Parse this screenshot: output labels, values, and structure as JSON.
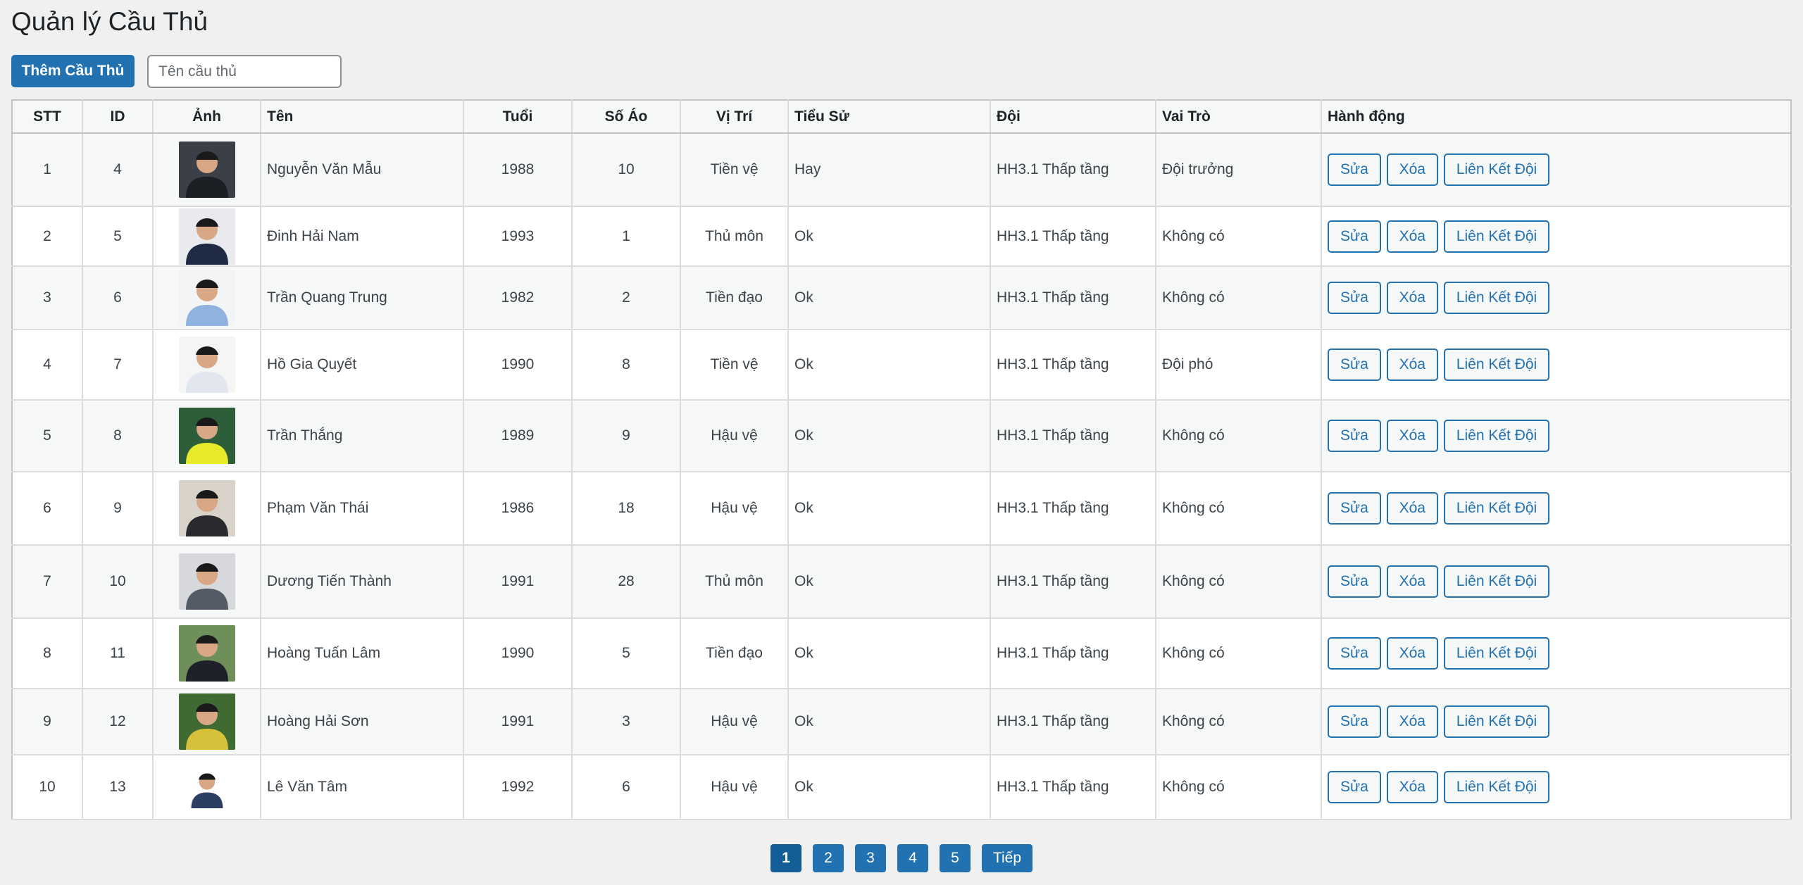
{
  "page": {
    "title": "Quản lý Cầu Thủ"
  },
  "toolbar": {
    "add_label": "Thêm Cầu Thủ",
    "search_placeholder": "Tên cầu thủ",
    "search_value": ""
  },
  "table": {
    "headers": [
      "STT",
      "ID",
      "Ảnh",
      "Tên",
      "Tuổi",
      "Số Áo",
      "Vị Trí",
      "Tiểu Sử",
      "Đội",
      "Vai Trò",
      "Hành động"
    ],
    "action_labels": {
      "edit": "Sửa",
      "delete": "Xóa",
      "link": "Liên Kết Đội"
    },
    "rows": [
      {
        "stt": "1",
        "id": "4",
        "name": "Nguyễn Văn Mẫu",
        "year": "1988",
        "number": "10",
        "position": "Tiền vệ",
        "bio": "Hay",
        "team": "HH3.1 Thấp tầng",
        "role": "Đội trưởng",
        "photo_bg": "#3a3f48",
        "photo_fg": "#1c1f24"
      },
      {
        "stt": "2",
        "id": "5",
        "name": "Đinh Hải Nam",
        "year": "1993",
        "number": "1",
        "position": "Thủ môn",
        "bio": "Ok",
        "team": "HH3.1 Thấp tầng",
        "role": "Không có",
        "photo_bg": "#e8eaee",
        "photo_fg": "#1f2a44"
      },
      {
        "stt": "3",
        "id": "6",
        "name": "Trần Quang Trung",
        "year": "1982",
        "number": "2",
        "position": "Tiền đạo",
        "bio": "Ok",
        "team": "HH3.1 Thấp tầng",
        "role": "Không có",
        "photo_bg": "#f3f4f6",
        "photo_fg": "#8fb3de"
      },
      {
        "stt": "4",
        "id": "7",
        "name": "Hồ Gia Quyết",
        "year": "1990",
        "number": "8",
        "position": "Tiền vệ",
        "bio": "Ok",
        "team": "HH3.1 Thấp tầng",
        "role": "Đội phó",
        "photo_bg": "#f5f5f5",
        "photo_fg": "#e2e6ee"
      },
      {
        "stt": "5",
        "id": "8",
        "name": "Trần Thắng",
        "year": "1989",
        "number": "9",
        "position": "Hậu vệ",
        "bio": "Ok",
        "team": "HH3.1 Thấp tầng",
        "role": "Không có",
        "photo_bg": "#2e5d3a",
        "photo_fg": "#e6ea2a"
      },
      {
        "stt": "6",
        "id": "9",
        "name": "Phạm Văn Thái",
        "year": "1986",
        "number": "18",
        "position": "Hậu vệ",
        "bio": "Ok",
        "team": "HH3.1 Thấp tầng",
        "role": "Không có",
        "photo_bg": "#d9d2c8",
        "photo_fg": "#2a2a2e"
      },
      {
        "stt": "7",
        "id": "10",
        "name": "Dương Tiến Thành",
        "year": "1991",
        "number": "28",
        "position": "Thủ môn",
        "bio": "Ok",
        "team": "HH3.1 Thấp tầng",
        "role": "Không có",
        "photo_bg": "#d6d8dc",
        "photo_fg": "#555b66"
      },
      {
        "stt": "8",
        "id": "11",
        "name": "Hoàng Tuấn Lâm",
        "year": "1990",
        "number": "5",
        "position": "Tiền đạo",
        "bio": "Ok",
        "team": "HH3.1 Thấp tầng",
        "role": "Không có",
        "photo_bg": "#6f8f5a",
        "photo_fg": "#1e2228"
      },
      {
        "stt": "9",
        "id": "12",
        "name": "Hoàng Hải Sơn",
        "year": "1991",
        "number": "3",
        "position": "Hậu vệ",
        "bio": "Ok",
        "team": "HH3.1 Thấp tầng",
        "role": "Không có",
        "photo_bg": "#3f6b33",
        "photo_fg": "#d6c23a"
      },
      {
        "stt": "10",
        "id": "13",
        "name": "Lê Văn Tâm",
        "year": "1992",
        "number": "6",
        "position": "Hậu vệ",
        "bio": "Ok",
        "team": "HH3.1 Thấp tầng",
        "role": "Không có",
        "photo_bg": "#ffffff",
        "photo_fg": "#2d3e63"
      }
    ]
  },
  "pagination": {
    "pages": [
      "1",
      "2",
      "3",
      "4",
      "5"
    ],
    "current": "1",
    "next_label": "Tiếp"
  },
  "colors": {
    "accent": "#2271b1",
    "accent_dark": "#135e96",
    "background": "#f0f0f1"
  }
}
